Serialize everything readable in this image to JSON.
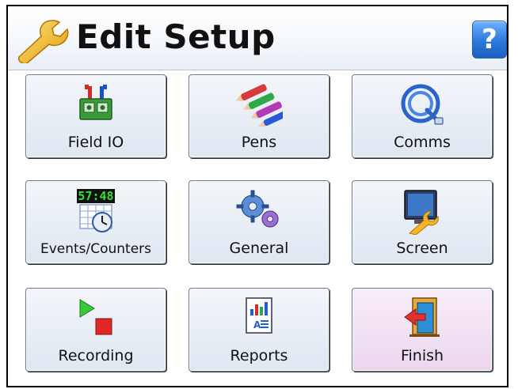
{
  "header": {
    "title": "Edit Setup",
    "help_label": "?"
  },
  "tiles": [
    {
      "label": "Field IO",
      "icon": "field-io-icon"
    },
    {
      "label": "Pens",
      "icon": "pens-icon"
    },
    {
      "label": "Comms",
      "icon": "comms-cable-icon"
    },
    {
      "label": "Events/Counters",
      "icon": "events-counters-icon",
      "clock": "57:48"
    },
    {
      "label": "General",
      "icon": "gears-icon"
    },
    {
      "label": "Screen",
      "icon": "screen-wrench-icon"
    },
    {
      "label": "Recording",
      "icon": "recording-icon"
    },
    {
      "label": "Reports",
      "icon": "reports-icon"
    },
    {
      "label": "Finish",
      "icon": "exit-door-icon"
    }
  ],
  "colors": {
    "tile_bg": "#dfe7f1",
    "finish_bg": "#ecd6ee",
    "help_blue": "#2f7de0",
    "wrench": "#f0b61c"
  }
}
